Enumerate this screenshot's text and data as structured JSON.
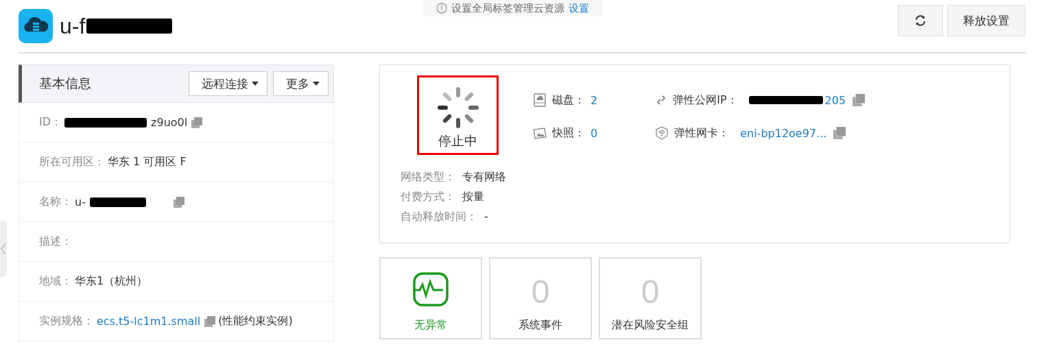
{
  "banner": {
    "text": "设置全局标签管理云资源",
    "link": "设置"
  },
  "header": {
    "title": {
      "before": "u-f",
      "redacted": true
    },
    "buttons": [
      {
        "kind": "icon"
      },
      {
        "kind": "text",
        "label": "释放设置"
      }
    ]
  },
  "basic_info": {
    "title": "基本信息",
    "actions": [
      "远程连接",
      "更多"
    ],
    "rows": [
      {
        "kind": "text",
        "label": "ID：",
        "redacted": true,
        "after": "z9uo0l",
        "copy": true
      },
      {
        "kind": "text",
        "label": "所在可用区：",
        "before": "华东 1 可用区 F",
        "redacted": false,
        "copy": false
      },
      {
        "kind": "text",
        "label": "名称：",
        "before": "u-",
        "redacted": true,
        "copy": true
      },
      {
        "label": "描述：",
        "redacted": false,
        "copy": false
      },
      {
        "kind": "text",
        "label": "地域：",
        "before": "华东1（杭州）",
        "redacted": false,
        "copy": false
      },
      {
        "kind": "link",
        "label": "实例规格：",
        "before": "ecs.t5-lc1m1.small",
        "redacted": false,
        "after": "(性能约束实例)",
        "copy": true
      }
    ]
  },
  "status": {
    "text": "停止中",
    "highlighted": true
  },
  "resources": [
    {
      "kind": "disk",
      "label": "磁盘：",
      "value": "2"
    },
    {
      "kind": "snapshot",
      "label": "快照：",
      "value": "0"
    }
  ],
  "network": [
    {
      "kind": "ip",
      "label": "弹性公网IP：",
      "redacted": true,
      "value": "205"
    },
    {
      "kind": "nic",
      "label": "弹性网卡：",
      "redacted": false,
      "value": "eni-bp12oe97..."
    }
  ],
  "details": [
    {
      "label": "网络类型：",
      "value": "专有网络"
    },
    {
      "label": "付费方式：",
      "value": "按量"
    },
    {
      "label": "自动释放时间：",
      "value": "-"
    }
  ],
  "health_cards": [
    {
      "kind": "ok",
      "text": "无异常"
    },
    {
      "kind": "count",
      "value": "0",
      "text": "系统事件"
    },
    {
      "kind": "count",
      "value": "0",
      "text": "潜在风险安全组"
    }
  ]
}
